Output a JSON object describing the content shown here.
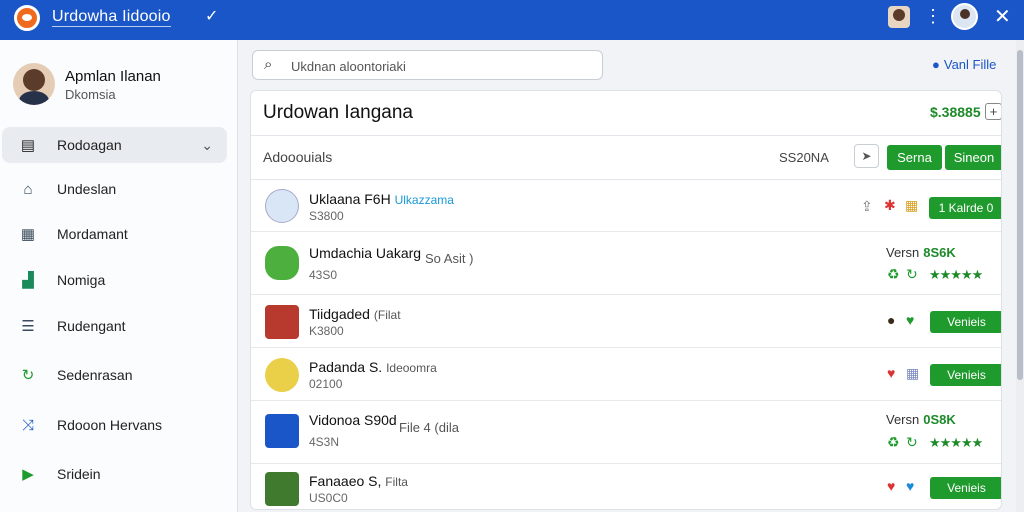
{
  "app": {
    "title": "Urdowha Iidooio"
  },
  "sidebar": {
    "profile": {
      "name": "Apmlan Ilanan",
      "subtitle": "Dkomsia"
    },
    "items": [
      {
        "label": "Rodoagan",
        "icon": "book-icon"
      },
      {
        "label": "Undeslan",
        "icon": "home-icon"
      },
      {
        "label": "Mordamant",
        "icon": "calendar-icon"
      },
      {
        "label": "Nomiga",
        "icon": "chart-icon"
      },
      {
        "label": "Rudengant",
        "icon": "list-icon"
      },
      {
        "label": "Sedenrasan",
        "icon": "refresh-icon"
      },
      {
        "label": "Rdooon Hervans",
        "icon": "share-icon"
      },
      {
        "label": "Sridein",
        "icon": "play-icon"
      }
    ]
  },
  "search": {
    "placeholder": "Ukdnan aloontoriaki"
  },
  "header": {
    "view_file": "Vanl Fille"
  },
  "panel": {
    "title": "Urdowan Iangana",
    "price": "$.38885",
    "sub_label": "Adooouials",
    "sub_price": "SS20NA",
    "btn_serna": "Serna",
    "btn_sineon": "Sineon"
  },
  "rows": [
    {
      "name": "Uklaana F6H",
      "tag": "Ulkazzama",
      "sub": "S3800",
      "extra": "",
      "action": "1 Kalrde",
      "count_badge": "0",
      "version": "",
      "count": ""
    },
    {
      "name": "Umdachia Uakarg",
      "tag": "",
      "sub": "43S0",
      "extra": "So Asit )",
      "action": "",
      "version": "Versn",
      "count": "8S6K"
    },
    {
      "name": "Tiidgaded",
      "tag": "(Filat",
      "sub": "K3800",
      "extra": "",
      "action": "Venieis",
      "version": "",
      "count": ""
    },
    {
      "name": "Padanda S.",
      "tag": "Ideoomra",
      "sub": "02100",
      "extra": "",
      "action": "Venieis",
      "version": "",
      "count": ""
    },
    {
      "name": "Vidonoa S90d",
      "tag": "",
      "sub": "4S3N",
      "extra": "File 4 (dila",
      "action": "",
      "version": "Versn",
      "count": "0S8K"
    },
    {
      "name": "Fanaaeo S,",
      "tag": "Filta",
      "sub": "US0C0",
      "extra": "",
      "action": "Venieis",
      "version": "",
      "count": ""
    }
  ],
  "colors": {
    "accent": "#1a56c7",
    "green": "#1f9a2d"
  }
}
